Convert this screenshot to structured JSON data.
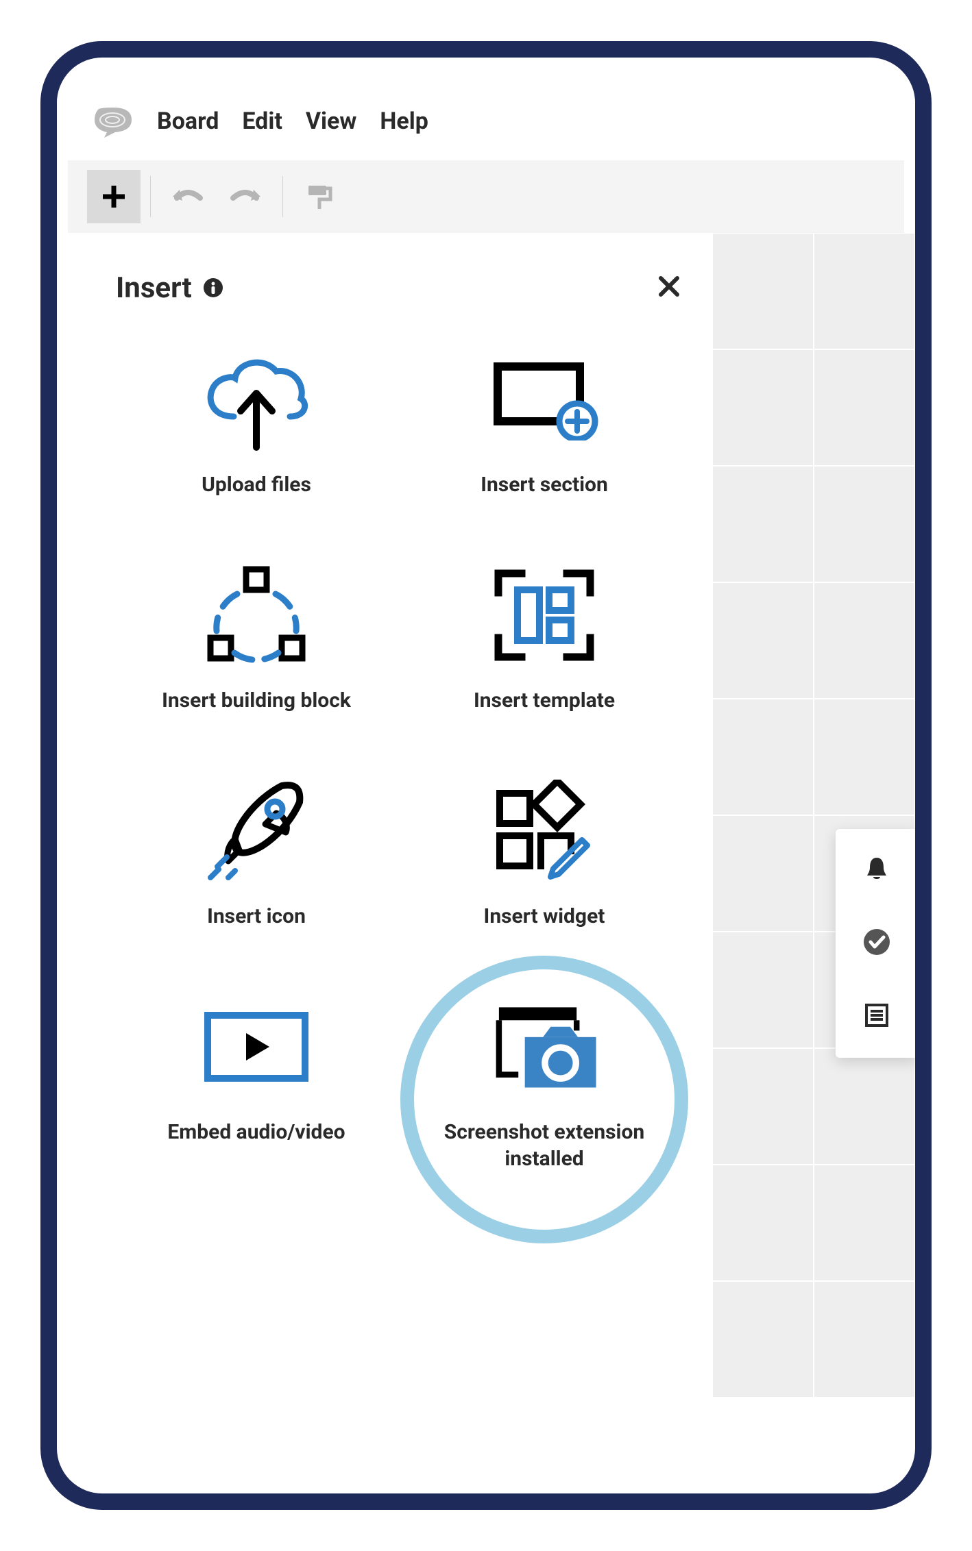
{
  "menubar": {
    "items": [
      "Board",
      "Edit",
      "View",
      "Help"
    ]
  },
  "panel": {
    "title": "Insert",
    "tiles": [
      {
        "label": "Upload files"
      },
      {
        "label": "Insert section"
      },
      {
        "label": "Insert building block"
      },
      {
        "label": "Insert template"
      },
      {
        "label": "Insert icon"
      },
      {
        "label": "Insert widget"
      },
      {
        "label": "Embed audio/video"
      },
      {
        "label": "Screenshot extension installed"
      }
    ],
    "highlighted_index": 7
  },
  "colors": {
    "accent_blue": "#2d7ec8",
    "frame_navy": "#1e2a5a",
    "highlight_ring": "#9acfe6"
  }
}
